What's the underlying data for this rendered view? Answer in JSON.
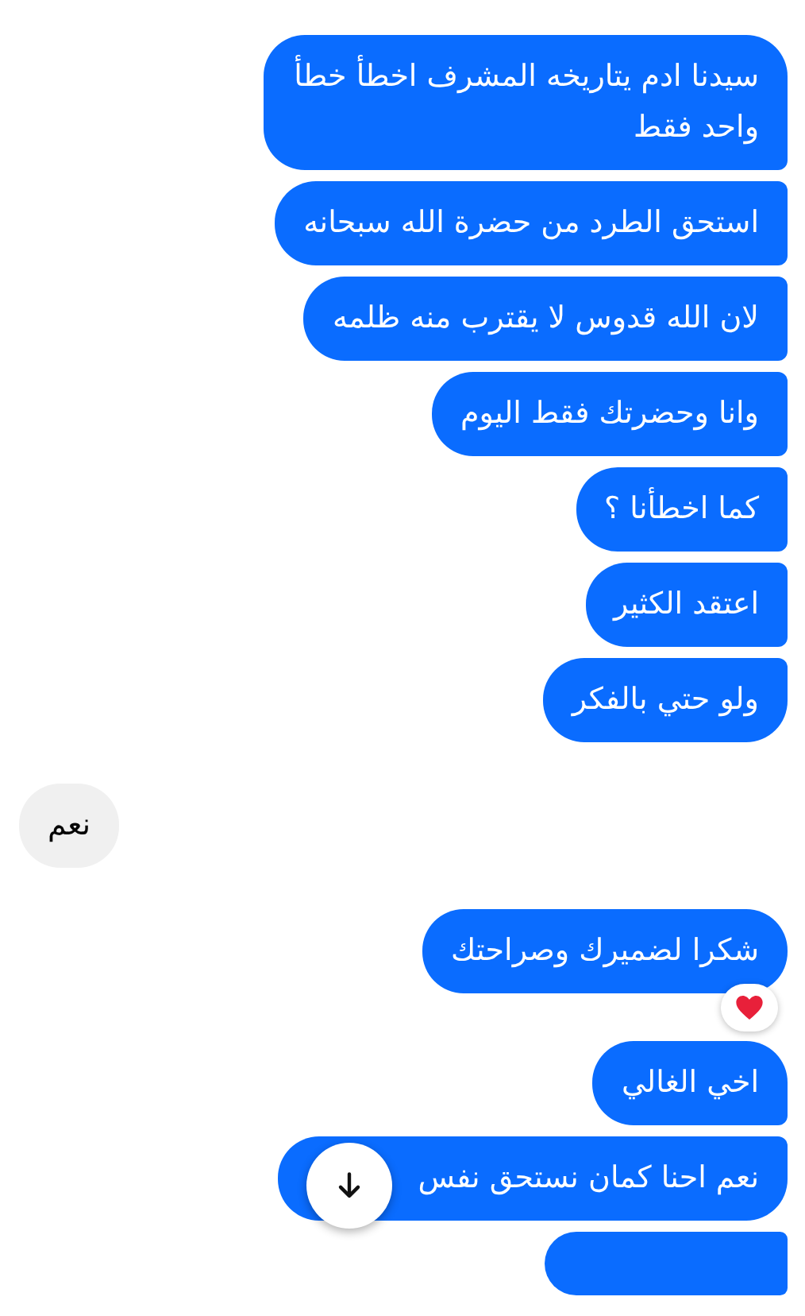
{
  "messages": [
    {
      "kind": "sent",
      "text": "سيدنا ادم يتاريخه المشرف اخطأ خطأ واحد فقط",
      "reaction": false
    },
    {
      "kind": "sent",
      "text": "استحق الطرد من حضرة الله سبحانه",
      "reaction": false
    },
    {
      "kind": "sent",
      "text": "لان الله قدوس لا يقترب منه ظلمه",
      "reaction": false
    },
    {
      "kind": "sent",
      "text": "وانا وحضرتك فقط اليوم",
      "reaction": false
    },
    {
      "kind": "sent",
      "text": "كما اخطأنا ؟",
      "reaction": false
    },
    {
      "kind": "sent",
      "text": "اعتقد الكثير",
      "reaction": false
    },
    {
      "kind": "sent",
      "text": "ولو حتي بالفكر",
      "reaction": false
    },
    {
      "kind": "received",
      "text": "نعم",
      "reaction": false
    },
    {
      "kind": "sent",
      "text": "شكرا لضميرك وصراحتك",
      "reaction": true
    },
    {
      "kind": "sent",
      "text": "اخي الغالي",
      "reaction": false
    },
    {
      "kind": "sent",
      "text": "نعم احنا كمان نستحق نفس",
      "reaction": false,
      "covered": true
    }
  ]
}
